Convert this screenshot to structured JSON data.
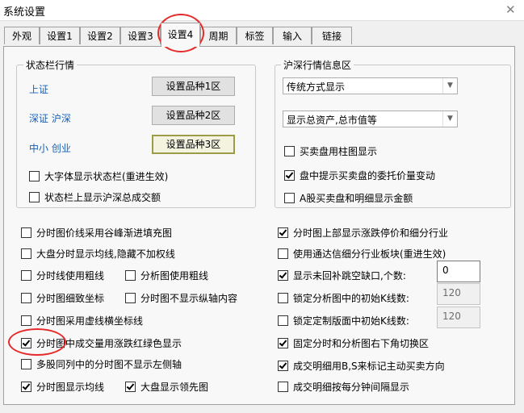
{
  "window": {
    "title": "系统设置",
    "close": "✕"
  },
  "tabs": [
    "外观",
    "设置1",
    "设置2",
    "设置3",
    "设置4",
    "周期",
    "标签",
    "输入",
    "链接"
  ],
  "status_group": {
    "legend": "状态栏行情",
    "rows": [
      {
        "label": "上证",
        "button": "设置品种1区"
      },
      {
        "label": "深证  沪深",
        "button": "设置品种2区"
      },
      {
        "label": "中小  创业",
        "button": "设置品种3区"
      }
    ],
    "checks": [
      {
        "label": "大字体显示状态栏(重进生效)",
        "checked": false
      },
      {
        "label": "状态栏上显示沪深总成交额",
        "checked": false
      }
    ]
  },
  "hs_group": {
    "legend": "沪深行情信息区",
    "combo1": "传统方式显示",
    "combo2": "显示总资产,总市值等",
    "checks": [
      {
        "label": "买卖盘用柱图显示",
        "checked": false
      },
      {
        "label": "盘中提示买卖盘的委托价量变动",
        "checked": true
      },
      {
        "label": "A股买卖盘和明细显示金额",
        "checked": false
      }
    ]
  },
  "left_options": {
    "r1": {
      "label": "分时图价线采用谷峰渐进填充图",
      "checked": false
    },
    "r2": {
      "label": "大盘分时显示均线,隐藏不加权线",
      "checked": false
    },
    "r3a": {
      "label": "分时线使用粗线",
      "checked": false
    },
    "r3b": {
      "label": "分析图使用粗线",
      "checked": false
    },
    "r4a": {
      "label": "分时图细致坐标",
      "checked": false
    },
    "r4b": {
      "label": "分时图不显示纵轴内容",
      "checked": false
    },
    "r5": {
      "label": "分时图采用虚线横坐标线",
      "checked": false
    },
    "r6": {
      "label": "分时图中成交量用涨跌红绿色显示",
      "checked": true
    },
    "r7": {
      "label": "多股同列中的分时图不显示左侧轴",
      "checked": false
    },
    "r8a": {
      "label": "分时图显示均线",
      "checked": true
    },
    "r8b": {
      "label": "大盘显示领先图",
      "checked": true
    }
  },
  "right_options": {
    "r1": {
      "label": "分时图上部显示涨跌停价和细分行业",
      "checked": true
    },
    "r2": {
      "label": "使用通达信细分行业板块(重进生效)",
      "checked": false
    },
    "r3": {
      "label": "显示未回补跳空缺口,个数:",
      "checked": true,
      "value": "0"
    },
    "r4": {
      "label": "锁定分析图中的初始K线数:",
      "checked": false,
      "value": "120"
    },
    "r5": {
      "label": "锁定定制版面中初始K线数:",
      "checked": false,
      "value": "120"
    },
    "r6": {
      "label": "固定分时和分析图右下角切换区",
      "checked": true
    },
    "r7": {
      "label": "成交明细用B,S来标记主动买卖方向",
      "checked": true
    },
    "r8": {
      "label": "成交明细按每分钟间隔显示",
      "checked": false
    }
  },
  "colors": {
    "accent_blue": "#1a5fb4",
    "annotation_red": "#e52a2a"
  }
}
